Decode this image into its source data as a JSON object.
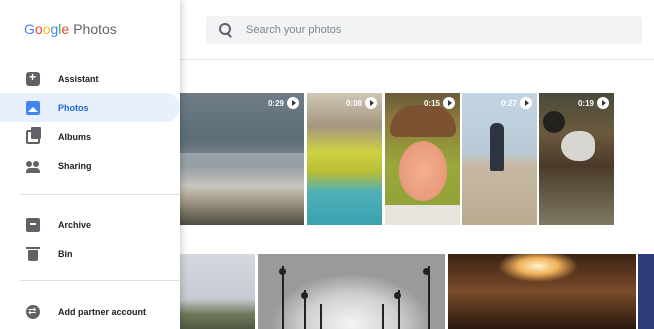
{
  "brand": {
    "google": [
      "G",
      "o",
      "o",
      "g",
      "l",
      "e"
    ],
    "product": "Photos"
  },
  "search": {
    "placeholder": "Search your photos"
  },
  "nav": {
    "assistant": "Assistant",
    "photos": "Photos",
    "albums": "Albums",
    "sharing": "Sharing",
    "archive": "Archive",
    "bin": "Bin",
    "partner": "Add partner account"
  },
  "videos": {
    "v1": "0:29",
    "v2": "0:08",
    "v3": "0:15",
    "v4": "0:27",
    "v5": "0:19"
  },
  "colors": {
    "active_bg": "#e8f0fe",
    "active_text": "#1967d2",
    "google_blue": "#4285f4",
    "google_red": "#ea4335",
    "google_yellow": "#fbbc05",
    "google_green": "#34a853"
  }
}
